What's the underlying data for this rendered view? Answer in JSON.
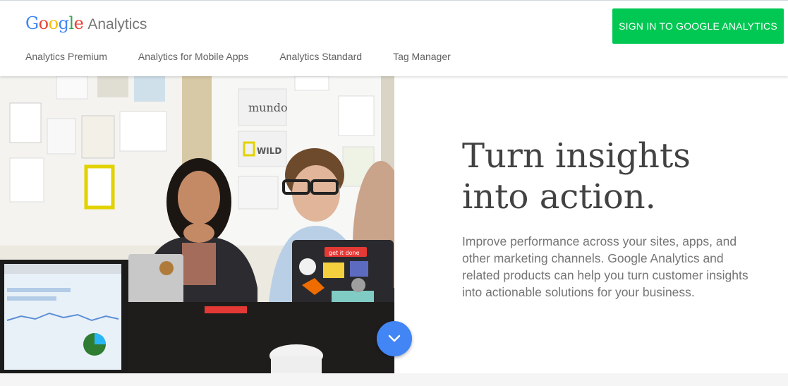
{
  "brand": {
    "google_letters": [
      "G",
      "o",
      "o",
      "g",
      "l",
      "e"
    ],
    "product": "Analytics"
  },
  "nav": {
    "items": [
      {
        "label": "Analytics Premium"
      },
      {
        "label": "Analytics for Mobile Apps"
      },
      {
        "label": "Analytics Standard"
      },
      {
        "label": "Tag Manager"
      }
    ]
  },
  "header": {
    "signin_label": "SIGN IN TO GOOGLE ANALYTICS"
  },
  "hero": {
    "headline_line1": "Turn insights",
    "headline_line2": "into action.",
    "body": "Improve performance across your sites, apps, and other marketing channels. Google Analytics and related products can help you turn customer insights into actionable solutions for your business.",
    "scroll_icon": "chevron-down-icon",
    "photo_labels": {
      "mundo": "mundo",
      "wild": "WILD",
      "nat_geo": "NATIONAL GEOGRAPHIC",
      "sticker": "get it done"
    }
  },
  "colors": {
    "signin_bg": "#00c853",
    "scroll_btn": "#4285f4",
    "headline": "#424242",
    "body_text": "#757575"
  }
}
